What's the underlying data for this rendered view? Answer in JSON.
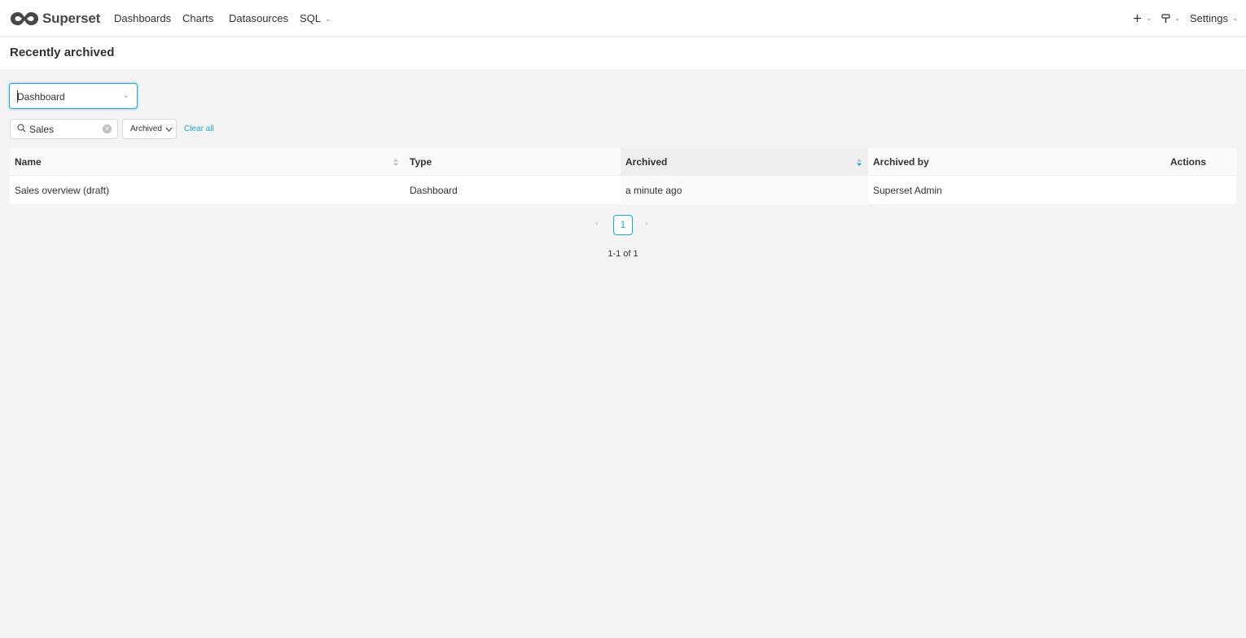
{
  "app": {
    "name": "Superset"
  },
  "nav": {
    "items": [
      {
        "label": "Dashboards"
      },
      {
        "label": "Charts"
      },
      {
        "label": "Datasources"
      },
      {
        "label": "SQL"
      }
    ],
    "right": {
      "settings_label": "Settings"
    }
  },
  "page": {
    "title": "Recently archived"
  },
  "type_filter": {
    "value": "Dashboard"
  },
  "search": {
    "value": "Sales"
  },
  "filter_chip": {
    "label": "Archived"
  },
  "clear_all_label": "Clear all",
  "table": {
    "columns": [
      {
        "label": "Name"
      },
      {
        "label": "Type"
      },
      {
        "label": "Archived"
      },
      {
        "label": "Archived by"
      },
      {
        "label": "Actions"
      }
    ],
    "rows": [
      {
        "name": "Sales overview (draft)",
        "type": "Dashboard",
        "archived": "a minute ago",
        "archived_by": "Superset Admin",
        "actions": ""
      }
    ]
  },
  "pagination": {
    "current": "1",
    "summary": "1-1 of 1"
  },
  "colors": {
    "accent": "#20a7c9",
    "text": "#323232",
    "background": "#f4f4f4"
  },
  "icons": [
    "superset-logo",
    "chevron-down-icon",
    "plus-icon",
    "theme-icon",
    "search-icon",
    "clear-icon",
    "sort-icon",
    "chevron-left-icon",
    "chevron-right-icon"
  ]
}
